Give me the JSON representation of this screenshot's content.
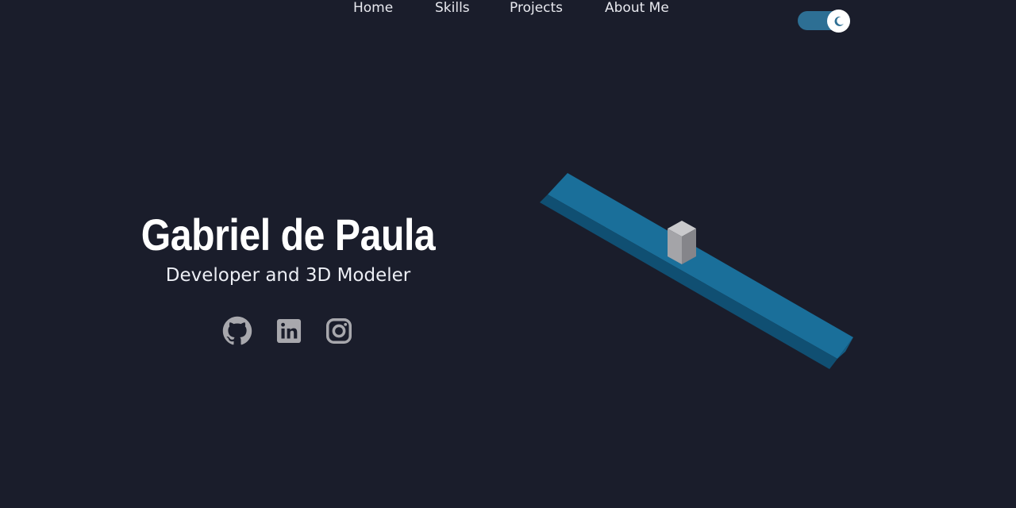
{
  "nav": {
    "items": [
      {
        "label": "Home"
      },
      {
        "label": "Skills"
      },
      {
        "label": "Projects"
      },
      {
        "label": "About Me"
      }
    ],
    "theme_toggle": {
      "mode": "dark",
      "icon": "moon-icon"
    }
  },
  "hero": {
    "title": "Gabriel de Paula",
    "subtitle": "Developer and 3D Modeler"
  },
  "socials": [
    {
      "icon": "github-icon"
    },
    {
      "icon": "linkedin-icon"
    },
    {
      "icon": "instagram-icon"
    }
  ],
  "colors": {
    "background": "#1a1d2b",
    "accent": "#1a6f9a",
    "icon_gray": "#a8a8ad",
    "text": "#ffffff"
  }
}
